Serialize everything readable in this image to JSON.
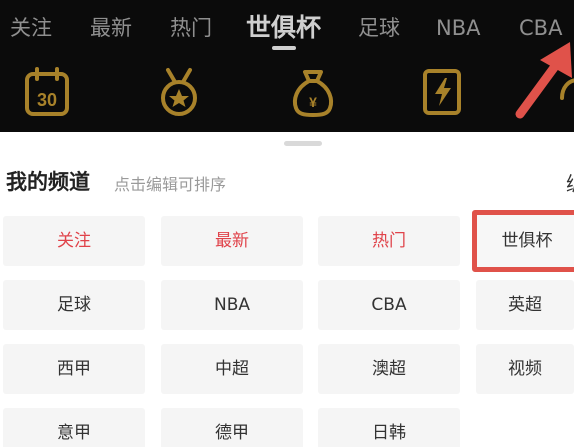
{
  "header": {
    "tabs": [
      {
        "label": "关注"
      },
      {
        "label": "最新"
      },
      {
        "label": "热门"
      },
      {
        "label": "世俱杯"
      },
      {
        "label": "足球"
      },
      {
        "label": "NBA"
      },
      {
        "label": "CBA"
      }
    ],
    "active_tab": "世俱杯",
    "icons": [
      {
        "name": "calendar-30-icon",
        "text": "30"
      },
      {
        "name": "medal-star-icon"
      },
      {
        "name": "money-bag-icon"
      },
      {
        "name": "lightning-card-icon"
      },
      {
        "name": "partial-icon"
      }
    ],
    "icon_color": "#a8822a",
    "arrow_color": "#e0524a"
  },
  "sheet": {
    "title": "我的频道",
    "hint": "点击编辑可排序",
    "edit_label_partial": "编",
    "channels": [
      {
        "label": "关注",
        "color": "red"
      },
      {
        "label": "最新",
        "color": "red"
      },
      {
        "label": "热门",
        "color": "red"
      },
      {
        "label": "世俱杯",
        "highlighted": true
      },
      {
        "label": "足球"
      },
      {
        "label": "NBA"
      },
      {
        "label": "CBA"
      },
      {
        "label": "英超"
      },
      {
        "label": "西甲"
      },
      {
        "label": "中超"
      },
      {
        "label": "澳超"
      },
      {
        "label": "视频"
      },
      {
        "label": "意甲"
      },
      {
        "label": "德甲"
      },
      {
        "label": "日韩"
      }
    ],
    "highlight_color": "#e0524a",
    "accent_red": "#e0434a"
  }
}
